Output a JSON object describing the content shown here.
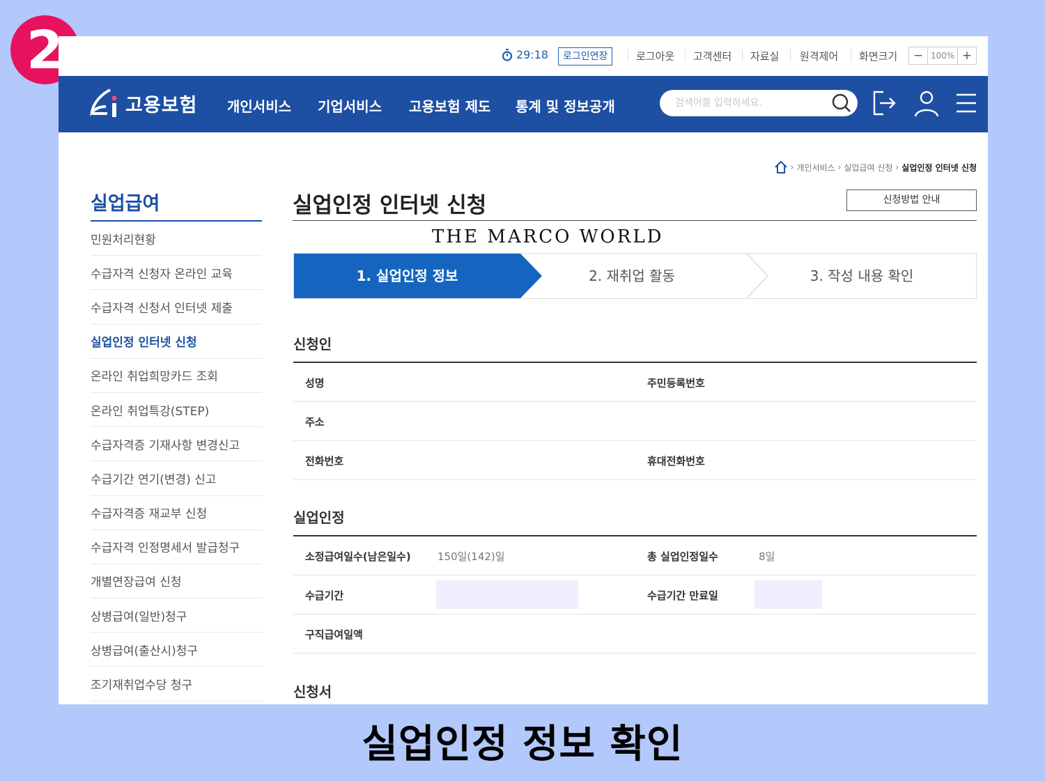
{
  "badge": "2",
  "utility": {
    "timer": "29:18",
    "extend_label": "로그인연장",
    "links": [
      "로그아웃",
      "고객센터",
      "자료실",
      "원격제어",
      "화면크기"
    ],
    "zoom_minus": "−",
    "zoom_value": "100%",
    "zoom_plus": "+"
  },
  "nav": {
    "logo_text": "고용보험",
    "menu": [
      "개인서비스",
      "기업서비스",
      "고용보험 제도",
      "통계 및 정보공개"
    ],
    "search_placeholder": "검색어를 입력하세요."
  },
  "breadcrumb": [
    "개인서비스",
    "실업급여 신청",
    "실업인정 인터넷 신청"
  ],
  "sidebar": {
    "title": "실업급여",
    "items": [
      "민원처리현황",
      "수급자격 신청자 온라인 교육",
      "수급자격 신청서 인터넷 제출",
      "실업인정 인터넷 신청",
      "온라인 취업희망카드 조회",
      "온라인 취업특강(STEP)",
      "수급자격증 기재사항 변경신고",
      "수급기간 연기(변경) 신고",
      "수급자격증 재교부 신청",
      "수급자격 인정명세서 발급청구",
      "개별연장급여 신청",
      "상병급여(일반)청구",
      "상병급여(출산시)청구",
      "조기재취업수당 청구"
    ],
    "active_index": 3
  },
  "main": {
    "title": "실업인정 인터넷 신청",
    "guide_button": "신청방법 안내",
    "watermark": "THE MARCO WORLD",
    "steps": [
      "1. 실업인정 정보",
      "2. 재취업 활동",
      "3. 작성 내용 확인"
    ],
    "applicant": {
      "title": "신청인",
      "name_label": "성명",
      "rrn_label": "주민등록번호",
      "address_label": "주소",
      "phone_label": "전화번호",
      "mobile_label": "휴대전화번호"
    },
    "recognition": {
      "title": "실업인정",
      "days_label": "소정급여일수(남은일수)",
      "days_value": "150일(142)일",
      "total_label": "총 실업인정일수",
      "total_value": "8일",
      "period_label": "수급기간",
      "expiry_label": "수급기간 만료일",
      "daily_label": "구직급여일액"
    },
    "application_title": "신청서"
  },
  "caption": "실업인정 정보 확인",
  "colors": {
    "background": "#b3c8fb",
    "badge": "#e7135e",
    "brand_blue": "#1d4fa3",
    "step_active": "#1565c0",
    "redacted": "#eeeefe"
  }
}
